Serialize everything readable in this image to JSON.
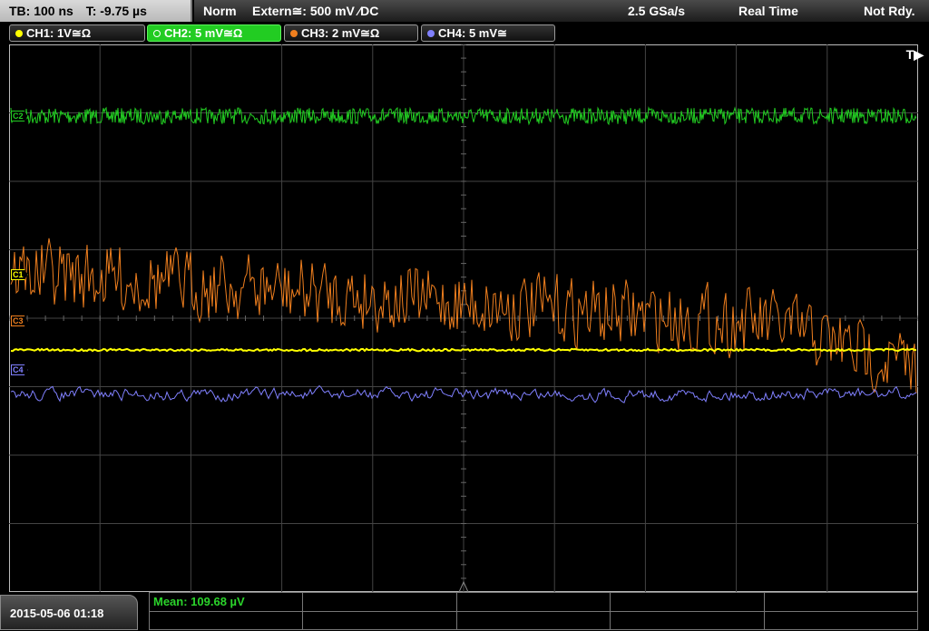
{
  "status": {
    "timebase": "TB: 100 ns",
    "trigger_time": "T: -9.75 µs",
    "mode": "Norm",
    "trigger_source": "Extern≅: 500 mV ⁄DC",
    "sample_rate": "2.5 GSa/s",
    "acquisition": "Real Time",
    "ready_state": "Not Rdy."
  },
  "channels": [
    {
      "label": "CH1: 1V≅Ω",
      "color": "#ffff00",
      "active": false
    },
    {
      "label": "CH2: 5 mV≅Ω",
      "color": "#22cc22",
      "active": true
    },
    {
      "label": "CH3: 2 mV≅Ω",
      "color": "#f07f1e",
      "active": false
    },
    {
      "label": "CH4: 5 mV≅",
      "color": "#8080ff",
      "active": false
    }
  ],
  "markers": {
    "ch2": "C2",
    "ch1": "C1",
    "ch3": "C3",
    "ch4": "C4"
  },
  "trigger_indicator": "T▶",
  "timestamp": "2015-05-06 01:18",
  "measurement": {
    "label": "Mean: 109.68 µV"
  },
  "colors": {
    "grid": "#444444",
    "background": "#000000"
  }
}
